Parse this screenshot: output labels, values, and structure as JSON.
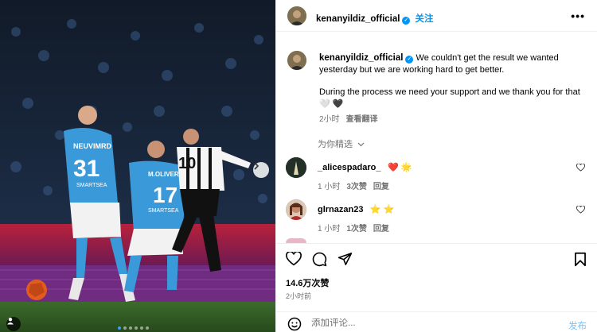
{
  "post": {
    "username": "kenanyildiz_official",
    "follow_label": "关注",
    "more_label": "•••"
  },
  "caption": {
    "username": "kenanyildiz_official",
    "text_1": "We couldn't get the result we wanted yesterday but we are working hard to get better.",
    "text_2": "During the process we need your support and we thank you for that 🤍 🖤",
    "time": "2小时",
    "translate_label": "查看翻译"
  },
  "recommended_label": "为你精选",
  "comments": [
    {
      "username": "_alicespadaro_",
      "text": "❤️ 🌟",
      "time": "1 小时",
      "likes": "3次赞",
      "reply": "回复"
    },
    {
      "username": "glrnazan23",
      "text": "⭐ ⭐",
      "time": "1 小时",
      "likes": "1次赞",
      "reply": "回复"
    }
  ],
  "actions": {
    "likes_text": "14.6万次赞",
    "age_text": "2小时前"
  },
  "compose": {
    "placeholder": "添加评论...",
    "post_label": "发布"
  },
  "media": {
    "jersey_1_name": "NEUVIMRD",
    "jersey_1_number": "31",
    "jersey_2_name": "M.OLIVERA",
    "jersey_2_number": "17",
    "jersey_3_number": "10",
    "sponsor": "SMARTSEA",
    "carousel_dots": 6,
    "active_dot": 0
  },
  "colors": {
    "accent": "#0095f6",
    "napoli_blue": "#3a9ad9",
    "secondary_text": "#737373"
  }
}
